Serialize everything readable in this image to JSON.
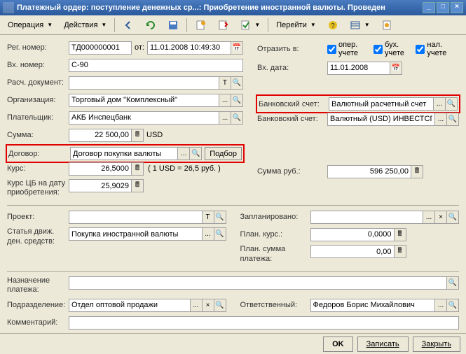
{
  "window": {
    "title": "Платежный ордер: поступление денежных ср...: Приобретение иностранной валюты. Проведен"
  },
  "toolbar": {
    "operation": "Операция",
    "actions": "Действия",
    "goto": "Перейти"
  },
  "labels": {
    "reg_num": "Рег. номер:",
    "ot": "от:",
    "in_num": "Вх. номер:",
    "rasch_doc": "Расч. документ:",
    "org": "Организация:",
    "platelshik": "Плательщик:",
    "summa": "Сумма:",
    "dogovor": "Договор:",
    "podbor": "Подбор",
    "kurs": "Курс:",
    "kurs_cb": "Курс ЦБ на дату приобретения:",
    "proekt": "Проект:",
    "statya": "Статья движ. ден. средств:",
    "naznachenie": "Назначение платежа:",
    "podrazdel": "Подразделение:",
    "kommentariy": "Комментарий:",
    "otrazit": "Отразить в:",
    "oper_uchete": "опер. учете",
    "buh_uchete": "бух. учете",
    "nal_uchete": "нал. учете",
    "vh_data": "Вх. дата:",
    "bank_schet": "Банковский счет:",
    "summa_rub": "Сумма руб.:",
    "zaplanirovano": "Запланировано:",
    "plan_kurs": "План. курс.:",
    "plan_summa": "План. сумма платежа:",
    "otvetstvenny": "Ответственный:"
  },
  "values": {
    "reg_num": "ТД000000001",
    "reg_date": "11.01.2008 10:49:30",
    "in_num": "С-90",
    "rasch_doc": "",
    "org": "Торговый дом \"Комплексный\"",
    "platelshik": "АКБ Инспецбанк",
    "summa": "22 500,00",
    "currency": "USD",
    "dogovor": "Договор покупки валюты",
    "kurs": "26,5000",
    "kurs_note": "( 1 USD = 26,5 руб. )",
    "kurs_cb": "25,9029",
    "proekt": "",
    "statya": "Покупка иностранной валюты",
    "naznachenie": "",
    "podrazdel": "Отдел оптовой продажи",
    "kommentariy": "",
    "vh_data": "11.01.2008",
    "bank_schet1": "Валютный расчетный счет",
    "bank_schet2": "Валютный (USD) ИНВЕСТСПЕЦБАНК",
    "summa_rub": "596 250,00",
    "zaplanirovano": "",
    "plan_kurs": "0,0000",
    "plan_summa": "0,00",
    "otvetstvenny": "Федоров Борис Михайлович"
  },
  "footer": {
    "ok": "OK",
    "zapisat": "Записать",
    "zakryt": "Закрыть"
  }
}
